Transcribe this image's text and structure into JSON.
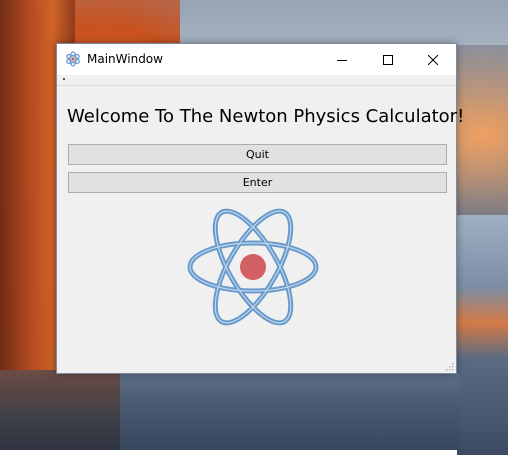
{
  "window": {
    "title": "MainWindow",
    "icon": "atom-icon"
  },
  "titlebar_buttons": {
    "minimize": "minimize-icon",
    "maximize": "maximize-icon",
    "close": "close-icon"
  },
  "main": {
    "heading": "Welcome To The Newton Physics Calculator!",
    "buttons": {
      "quit_label": "Quit",
      "enter_label": "Enter"
    },
    "image": "atom-logo"
  },
  "colors": {
    "atom_orbit": "#6699cc",
    "atom_nucleus": "#d36063",
    "window_bg": "#f0f0f0",
    "button_bg": "#e1e1e1",
    "button_border": "#adadad"
  }
}
